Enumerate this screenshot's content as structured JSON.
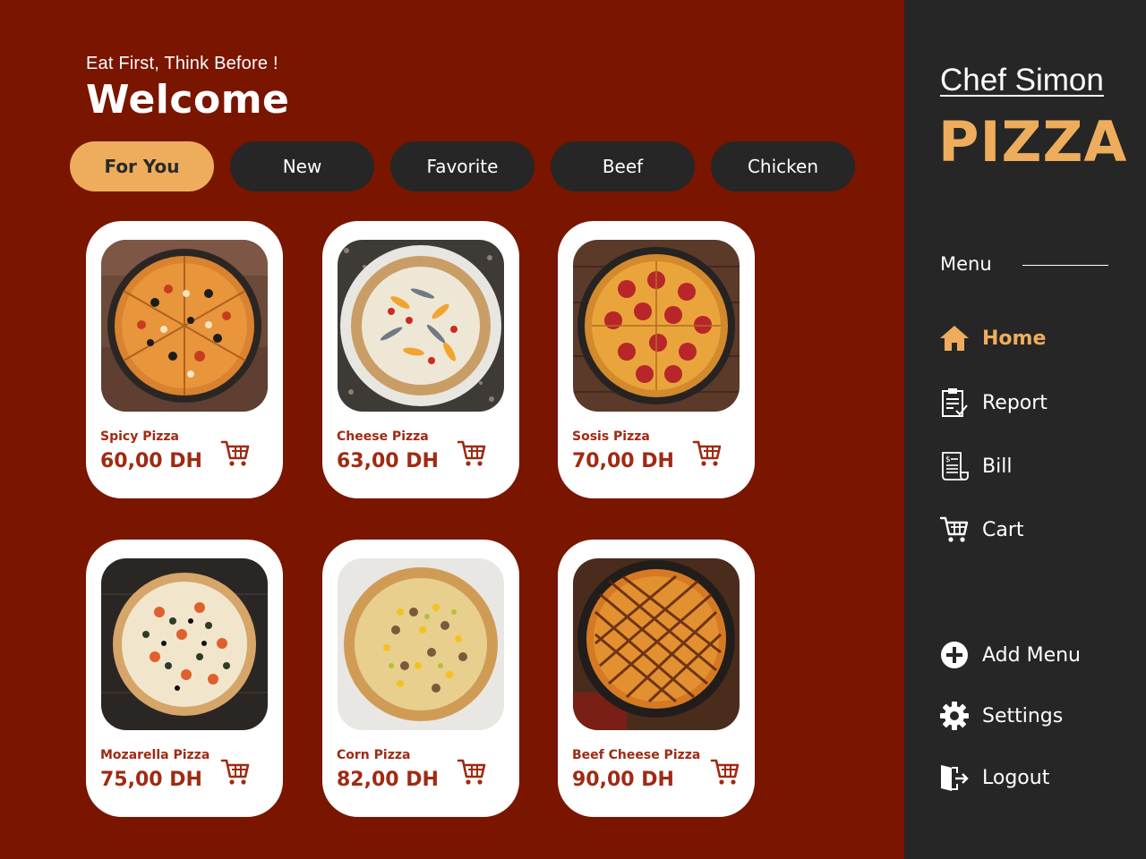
{
  "header": {
    "tagline": "Eat First, Think Before !",
    "title": "Welcome"
  },
  "tabs": [
    {
      "label": "For You",
      "active": true
    },
    {
      "label": "New",
      "active": false
    },
    {
      "label": "Favorite",
      "active": false
    },
    {
      "label": "Beef",
      "active": false
    },
    {
      "label": "Chicken",
      "active": false
    }
  ],
  "products": [
    {
      "name": "Spicy Pizza",
      "price": "60,00 DH",
      "icon": "cart-icon"
    },
    {
      "name": "Cheese Pizza",
      "price": "63,00 DH",
      "icon": "cart-icon"
    },
    {
      "name": "Sosis Pizza",
      "price": "70,00 DH",
      "icon": "cart-icon"
    },
    {
      "name": "Mozarella Pizza",
      "price": "75,00 DH",
      "icon": "cart-icon"
    },
    {
      "name": "Corn Pizza",
      "price": "82,00 DH",
      "icon": "cart-icon"
    },
    {
      "name": "Beef Cheese Pizza",
      "price": "90,00 DH",
      "icon": "cart-icon"
    }
  ],
  "sidebar": {
    "chef": "Chef Simon",
    "brand": "PIZZA",
    "menu_label": "Menu",
    "nav": [
      {
        "label": "Home",
        "icon": "home-icon",
        "active": true
      },
      {
        "label": "Report",
        "icon": "report-icon",
        "active": false
      },
      {
        "label": "Bill",
        "icon": "bill-icon",
        "active": false
      },
      {
        "label": "Cart",
        "icon": "cart-icon",
        "active": false
      }
    ],
    "bottom": [
      {
        "label": "Add Menu",
        "icon": "plus-circle-icon"
      },
      {
        "label": "Settings",
        "icon": "gear-icon"
      },
      {
        "label": "Logout",
        "icon": "logout-icon"
      }
    ]
  },
  "colors": {
    "background": "#7a1500",
    "sidebar": "#262626",
    "accent": "#eead5c",
    "price": "#a02a12"
  }
}
